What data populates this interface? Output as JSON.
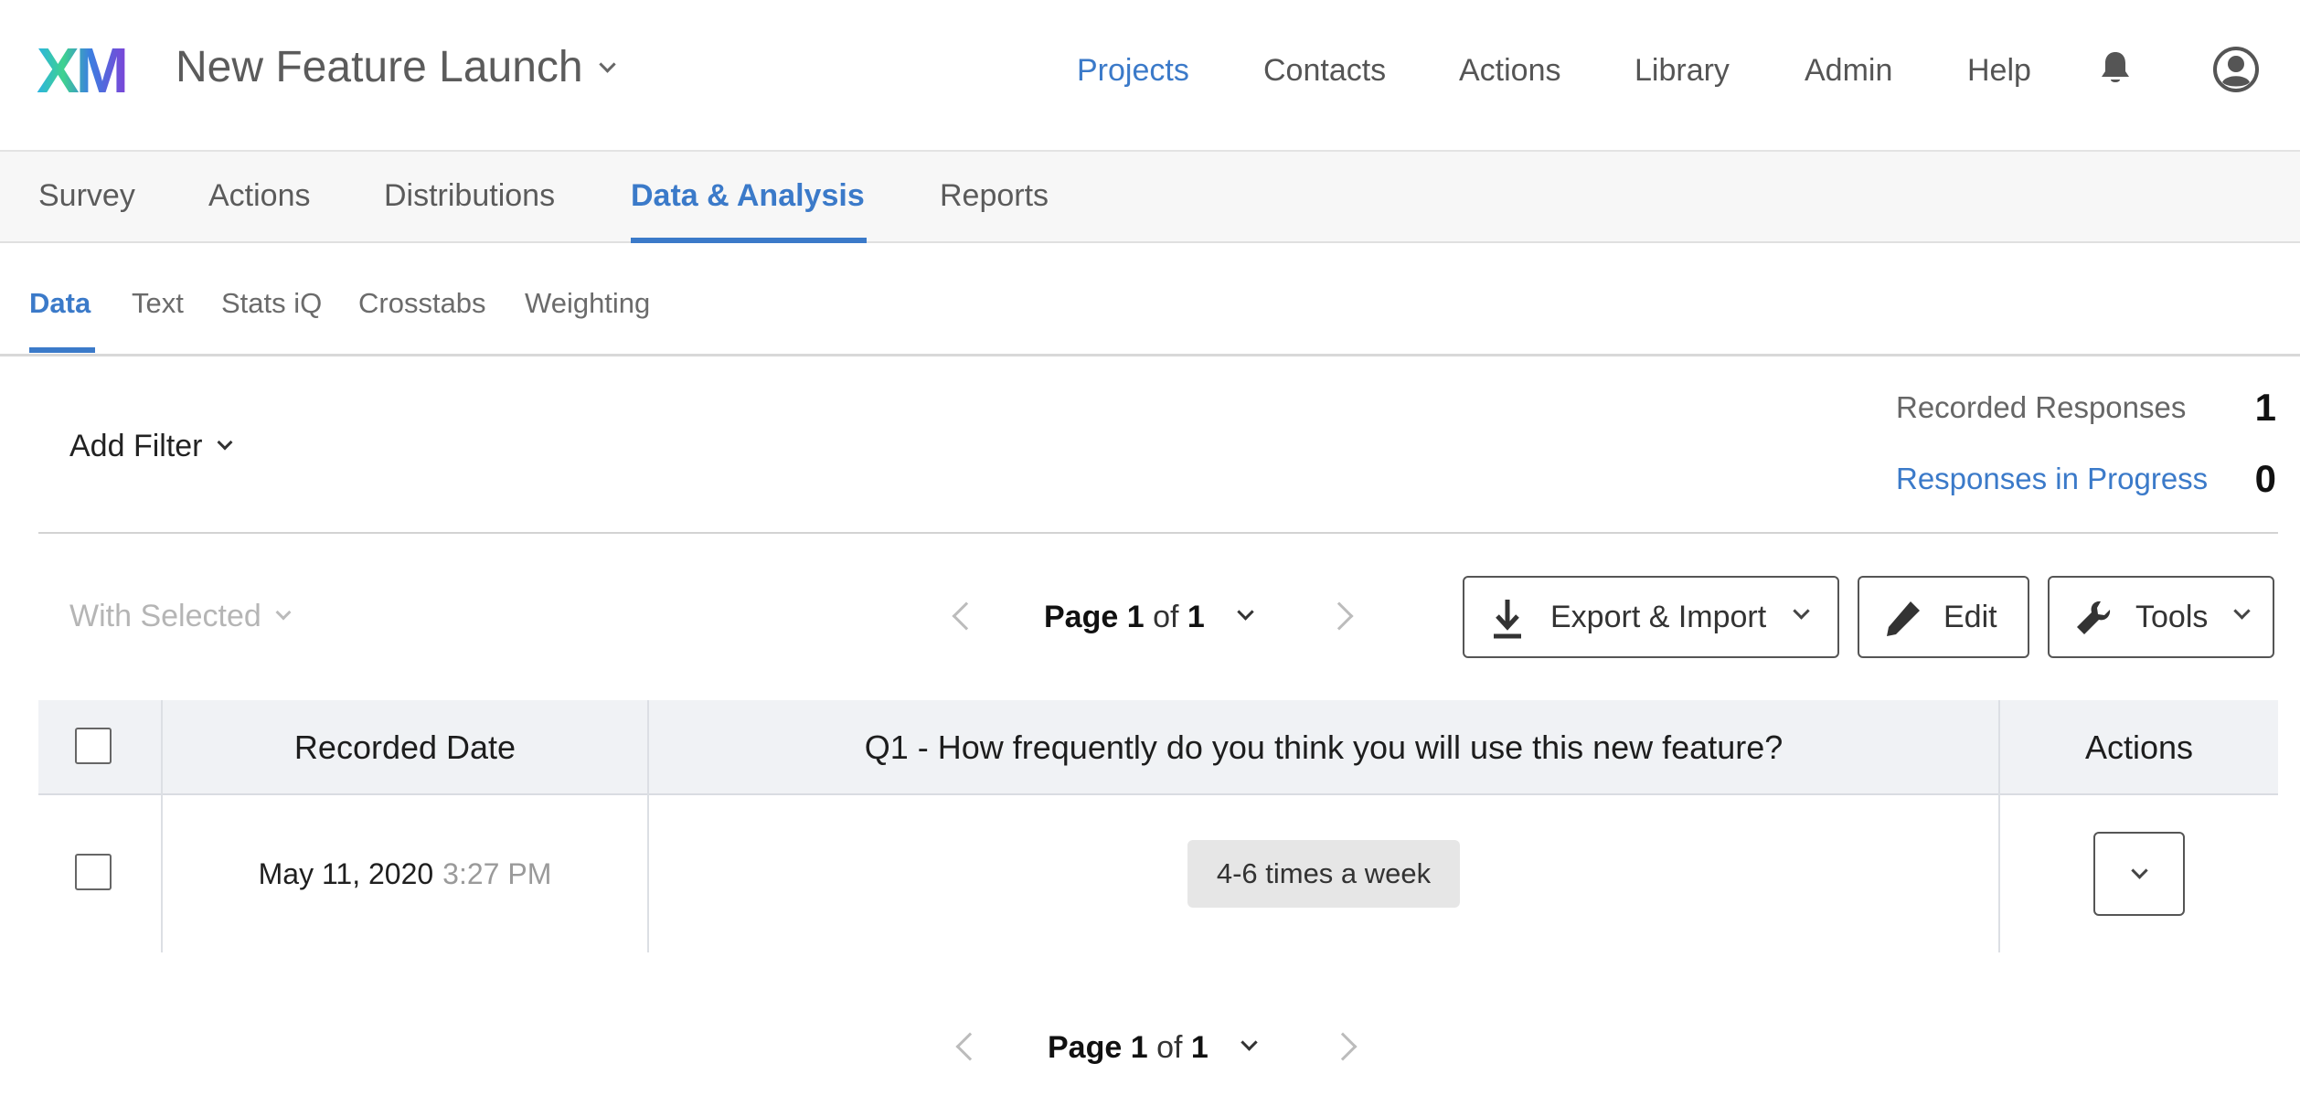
{
  "header": {
    "logo": "XM",
    "project_title": "New Feature Launch",
    "nav": [
      {
        "label": "Projects",
        "active": true
      },
      {
        "label": "Contacts",
        "active": false
      },
      {
        "label": "Actions",
        "active": false
      },
      {
        "label": "Library",
        "active": false
      },
      {
        "label": "Admin",
        "active": false
      },
      {
        "label": "Help",
        "active": false
      }
    ],
    "icons": [
      "bell-icon",
      "user-icon"
    ]
  },
  "tabs": [
    {
      "label": "Survey",
      "active": false
    },
    {
      "label": "Actions",
      "active": false
    },
    {
      "label": "Distributions",
      "active": false
    },
    {
      "label": "Data & Analysis",
      "active": true
    },
    {
      "label": "Reports",
      "active": false
    }
  ],
  "subtabs": [
    {
      "label": "Data",
      "active": true
    },
    {
      "label": "Text",
      "active": false
    },
    {
      "label": "Stats iQ",
      "active": false
    },
    {
      "label": "Crosstabs",
      "active": false
    },
    {
      "label": "Weighting",
      "active": false
    }
  ],
  "filter": {
    "add_filter_label": "Add Filter"
  },
  "stats": {
    "recorded_label": "Recorded Responses",
    "recorded_value": "1",
    "in_progress_label": "Responses in Progress",
    "in_progress_value": "0"
  },
  "toolbar": {
    "with_selected_label": "With Selected",
    "pager": {
      "page_word": "Page",
      "current": "1",
      "of_word": "of",
      "total": "1"
    },
    "export_label": "Export & Import",
    "edit_label": "Edit",
    "tools_label": "Tools"
  },
  "table": {
    "columns": [
      "Recorded Date",
      "Q1 - How frequently do you think you will use this new feature?",
      "Actions"
    ],
    "rows": [
      {
        "date": "May 11, 2020",
        "time": "3:27 PM",
        "answer": "4-6 times a week"
      }
    ]
  },
  "colors": {
    "accent": "#3b7ac9",
    "header_bg": "#f7f7f7",
    "table_header_bg": "#f0f2f5"
  }
}
